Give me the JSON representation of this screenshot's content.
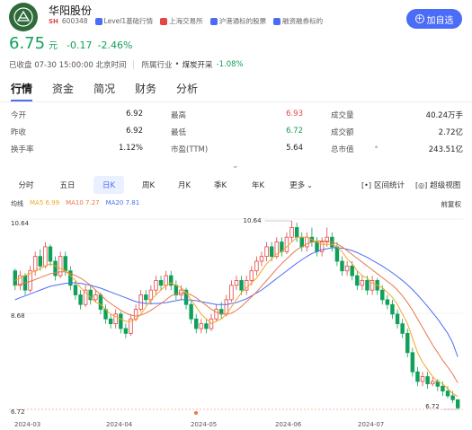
{
  "stock": {
    "name": "华阳股份",
    "market": "SH",
    "code": "600348",
    "tags": [
      {
        "label": "Level1基础行情",
        "icon": "level1-icon",
        "color": "#4a6cf7"
      },
      {
        "label": "上海交易所",
        "icon": "china-flag-icon",
        "color": "#e64545"
      },
      {
        "label": "沪港通标的股票",
        "icon": "hk-connect-icon",
        "color": "#4a6cf7"
      },
      {
        "label": "融资融券标的",
        "icon": "margin-icon",
        "color": "#4a6cf7"
      }
    ],
    "watch_button": "加自选"
  },
  "price": {
    "last": "6.75",
    "unit": "元",
    "change": "-0.17",
    "change_pct": "-2.46%",
    "status": "已收盘 07-30 15:00:00 北京时间",
    "industry_label": "所属行业",
    "industry_name": "煤炭开采",
    "industry_change": "-1.08%"
  },
  "tabs": [
    "行情",
    "资金",
    "简况",
    "财务",
    "分析"
  ],
  "quote": {
    "rows": [
      [
        {
          "label": "今开",
          "value": "6.92"
        },
        {
          "label": "最高",
          "value": "6.93",
          "color": "red"
        },
        {
          "label": "成交量",
          "value": "40.24万手"
        }
      ],
      [
        {
          "label": "昨收",
          "value": "6.92"
        },
        {
          "label": "最低",
          "value": "6.72",
          "color": "green"
        },
        {
          "label": "成交额",
          "value": "2.72亿"
        }
      ],
      [
        {
          "label": "换手率",
          "value": "1.12%"
        },
        {
          "label": "市盈(TTM)",
          "value": "5.64"
        },
        {
          "label": "总市值",
          "value": "243.51亿"
        }
      ]
    ]
  },
  "periods": [
    "分时",
    "五日",
    "日K",
    "周K",
    "月K",
    "季K",
    "年K",
    "更多"
  ],
  "active_period": "日K",
  "tools": {
    "stats": "区间统计",
    "super": "超级视图"
  },
  "legend": {
    "title": "均线",
    "ma5": "MA5 6.99",
    "ma10": "MA10 7.27",
    "ma20": "MA20 7.81",
    "adjust": "前复权"
  },
  "colors": {
    "up": "#e64545",
    "down": "#11a05a",
    "ma5": "#f5a623",
    "ma10": "#e8774a",
    "ma20": "#4a6cf7",
    "accent": "#4a6cf7"
  },
  "chart_data": {
    "type": "candlestick",
    "y_labels": [
      "10.64",
      "8.68",
      "6.72"
    ],
    "ylim": [
      6.72,
      10.64
    ],
    "x_labels": [
      "2024-03",
      "2024-04",
      "2024-05",
      "2024-06",
      "2024-07"
    ],
    "max_marker": "10.64",
    "min_marker": "6.72",
    "candles": [
      [
        9.6,
        9.3,
        9.65,
        9.2
      ],
      [
        9.3,
        9.5,
        9.6,
        9.2
      ],
      [
        9.5,
        9.2,
        9.55,
        9.1
      ],
      [
        9.2,
        9.6,
        9.7,
        9.15
      ],
      [
        9.6,
        9.9,
        10.0,
        9.5
      ],
      [
        9.9,
        9.7,
        10.05,
        9.6
      ],
      [
        9.7,
        10.1,
        10.2,
        9.65
      ],
      [
        10.1,
        9.8,
        10.15,
        9.7
      ],
      [
        9.8,
        9.5,
        9.9,
        9.4
      ],
      [
        9.5,
        9.9,
        10.0,
        9.45
      ],
      [
        9.9,
        9.6,
        10.0,
        9.5
      ],
      [
        9.6,
        9.3,
        9.7,
        9.2
      ],
      [
        9.3,
        9.1,
        9.4,
        9.0
      ],
      [
        9.1,
        8.9,
        9.2,
        8.8
      ],
      [
        8.9,
        9.2,
        9.3,
        8.85
      ],
      [
        9.2,
        9.0,
        9.3,
        8.9
      ],
      [
        9.0,
        9.1,
        9.2,
        8.95
      ],
      [
        9.1,
        8.8,
        9.15,
        8.7
      ],
      [
        8.8,
        8.6,
        8.9,
        8.5
      ],
      [
        8.6,
        8.5,
        8.7,
        8.4
      ],
      [
        8.5,
        8.7,
        8.8,
        8.4
      ],
      [
        8.7,
        8.4,
        8.75,
        8.3
      ],
      [
        8.4,
        8.3,
        8.5,
        8.2
      ],
      [
        8.3,
        8.6,
        8.7,
        8.25
      ],
      [
        8.6,
        8.8,
        8.9,
        8.55
      ],
      [
        8.8,
        9.1,
        9.2,
        8.75
      ],
      [
        9.1,
        9.0,
        9.2,
        8.9
      ],
      [
        9.0,
        9.2,
        9.3,
        8.9
      ],
      [
        9.2,
        9.4,
        9.5,
        9.1
      ],
      [
        9.4,
        9.3,
        9.5,
        9.2
      ],
      [
        9.3,
        9.5,
        9.6,
        9.2
      ],
      [
        9.5,
        9.3,
        9.6,
        9.2
      ],
      [
        9.3,
        9.1,
        9.4,
        9.0
      ],
      [
        9.1,
        9.2,
        9.3,
        9.0
      ],
      [
        9.2,
        8.9,
        9.25,
        8.8
      ],
      [
        8.9,
        8.6,
        9.0,
        8.5
      ],
      [
        8.6,
        8.4,
        8.7,
        8.3
      ],
      [
        8.4,
        8.5,
        8.6,
        8.3
      ],
      [
        8.5,
        8.4,
        8.6,
        8.3
      ],
      [
        8.4,
        8.6,
        8.7,
        8.35
      ],
      [
        8.6,
        8.8,
        8.9,
        8.55
      ],
      [
        8.8,
        8.7,
        8.95,
        8.6
      ],
      [
        8.7,
        9.0,
        9.1,
        8.65
      ],
      [
        9.0,
        9.3,
        9.4,
        8.95
      ],
      [
        9.3,
        9.4,
        9.5,
        9.2
      ],
      [
        9.4,
        9.2,
        9.5,
        9.1
      ],
      [
        9.2,
        9.4,
        9.5,
        9.1
      ],
      [
        9.4,
        9.6,
        9.7,
        9.3
      ],
      [
        9.6,
        9.8,
        9.9,
        9.5
      ],
      [
        9.8,
        9.9,
        10.0,
        9.7
      ],
      [
        9.9,
        10.1,
        10.2,
        9.8
      ],
      [
        10.1,
        9.9,
        10.2,
        9.8
      ],
      [
        9.9,
        10.2,
        10.3,
        9.85
      ],
      [
        10.2,
        10.0,
        10.3,
        9.9
      ],
      [
        10.0,
        10.3,
        10.4,
        9.95
      ],
      [
        10.3,
        10.5,
        10.64,
        10.2
      ],
      [
        10.5,
        10.3,
        10.6,
        10.2
      ],
      [
        10.3,
        10.1,
        10.4,
        10.0
      ],
      [
        10.1,
        10.3,
        10.4,
        10.0
      ],
      [
        10.3,
        10.2,
        10.5,
        10.1
      ],
      [
        10.2,
        10.0,
        10.3,
        9.9
      ],
      [
        10.0,
        10.2,
        10.3,
        9.9
      ],
      [
        10.2,
        10.3,
        10.5,
        10.1
      ],
      [
        10.3,
        10.1,
        10.4,
        10.0
      ],
      [
        10.1,
        9.8,
        10.2,
        9.7
      ],
      [
        9.8,
        9.6,
        9.9,
        9.5
      ],
      [
        9.6,
        9.7,
        9.8,
        9.5
      ],
      [
        9.7,
        9.5,
        9.8,
        9.4
      ],
      [
        9.5,
        9.3,
        9.6,
        9.2
      ],
      [
        9.3,
        9.4,
        9.5,
        9.2
      ],
      [
        9.4,
        9.2,
        9.5,
        9.1
      ],
      [
        9.2,
        9.4,
        9.5,
        9.1
      ],
      [
        9.4,
        9.2,
        9.45,
        9.1
      ],
      [
        9.2,
        9.0,
        9.3,
        8.9
      ],
      [
        9.0,
        8.9,
        9.1,
        8.8
      ],
      [
        8.9,
        8.7,
        9.0,
        8.6
      ],
      [
        8.7,
        8.5,
        8.8,
        8.4
      ],
      [
        8.5,
        8.3,
        8.6,
        8.2
      ],
      [
        8.3,
        7.9,
        8.4,
        7.8
      ],
      [
        7.9,
        7.5,
        8.0,
        7.4
      ],
      [
        7.5,
        7.3,
        7.6,
        7.2
      ],
      [
        7.3,
        7.4,
        7.5,
        7.2
      ],
      [
        7.4,
        7.25,
        7.5,
        7.15
      ],
      [
        7.25,
        7.3,
        7.4,
        7.2
      ],
      [
        7.3,
        7.2,
        7.35,
        7.1
      ],
      [
        7.2,
        7.1,
        7.3,
        7.0
      ],
      [
        7.1,
        7.0,
        7.2,
        6.95
      ],
      [
        7.0,
        6.92,
        7.1,
        6.85
      ],
      [
        6.92,
        6.75,
        6.93,
        6.72
      ]
    ],
    "ma5": [
      9.4,
      9.45,
      9.5,
      9.55,
      9.6,
      9.65,
      9.7,
      9.75,
      9.7,
      9.65,
      9.6,
      9.5,
      9.4,
      9.25,
      9.15,
      9.05,
      8.95,
      8.9,
      8.8,
      8.7,
      8.65,
      8.6,
      8.55,
      8.55,
      8.6,
      8.7,
      8.85,
      9.0,
      9.1,
      9.2,
      9.3,
      9.35,
      9.3,
      9.25,
      9.15,
      9.0,
      8.85,
      8.7,
      8.6,
      8.5,
      8.55,
      8.6,
      8.7,
      8.85,
      9.0,
      9.15,
      9.25,
      9.35,
      9.45,
      9.6,
      9.75,
      9.85,
      9.95,
      10.0,
      10.1,
      10.2,
      10.3,
      10.3,
      10.3,
      10.25,
      10.2,
      10.15,
      10.15,
      10.15,
      10.1,
      10.0,
      9.85,
      9.75,
      9.6,
      9.5,
      9.45,
      9.35,
      9.3,
      9.25,
      9.15,
      9.05,
      8.9,
      8.7,
      8.5,
      8.2,
      7.9,
      7.7,
      7.55,
      7.4,
      7.3,
      7.25,
      7.15,
      7.05,
      6.99
    ],
    "ma10": [
      9.3,
      9.32,
      9.35,
      9.38,
      9.42,
      9.46,
      9.5,
      9.54,
      9.56,
      9.58,
      9.58,
      9.55,
      9.5,
      9.45,
      9.38,
      9.3,
      9.2,
      9.1,
      9.0,
      8.92,
      8.85,
      8.78,
      8.72,
      8.68,
      8.66,
      8.68,
      8.72,
      8.78,
      8.85,
      8.92,
      9.0,
      9.08,
      9.12,
      9.14,
      9.14,
      9.1,
      9.04,
      8.96,
      8.88,
      8.8,
      8.74,
      8.7,
      8.7,
      8.72,
      8.78,
      8.86,
      8.96,
      9.06,
      9.16,
      9.28,
      9.4,
      9.52,
      9.64,
      9.75,
      9.85,
      9.95,
      10.04,
      10.1,
      10.16,
      10.2,
      10.22,
      10.22,
      10.22,
      10.2,
      10.16,
      10.1,
      10.02,
      9.94,
      9.86,
      9.78,
      9.7,
      9.62,
      9.54,
      9.46,
      9.38,
      9.3,
      9.2,
      9.08,
      8.94,
      8.78,
      8.6,
      8.42,
      8.24,
      8.06,
      7.9,
      7.74,
      7.6,
      7.45,
      7.27
    ],
    "ma20": [
      9.0,
      9.04,
      9.08,
      9.12,
      9.16,
      9.2,
      9.24,
      9.28,
      9.3,
      9.32,
      9.34,
      9.35,
      9.35,
      9.34,
      9.32,
      9.3,
      9.27,
      9.24,
      9.2,
      9.16,
      9.12,
      9.08,
      9.04,
      9.0,
      8.96,
      8.94,
      8.92,
      8.92,
      8.92,
      8.93,
      8.94,
      8.96,
      8.98,
      9.0,
      9.0,
      8.99,
      8.98,
      8.96,
      8.94,
      8.92,
      8.9,
      8.9,
      8.9,
      8.92,
      8.94,
      8.98,
      9.02,
      9.08,
      9.14,
      9.2,
      9.28,
      9.36,
      9.44,
      9.52,
      9.6,
      9.68,
      9.76,
      9.83,
      9.9,
      9.96,
      10.0,
      10.04,
      10.06,
      10.08,
      10.08,
      10.07,
      10.05,
      10.02,
      9.98,
      9.93,
      9.88,
      9.82,
      9.76,
      9.7,
      9.63,
      9.56,
      9.48,
      9.4,
      9.31,
      9.21,
      9.1,
      8.98,
      8.86,
      8.73,
      8.6,
      8.45,
      8.3,
      8.1,
      7.81
    ]
  }
}
